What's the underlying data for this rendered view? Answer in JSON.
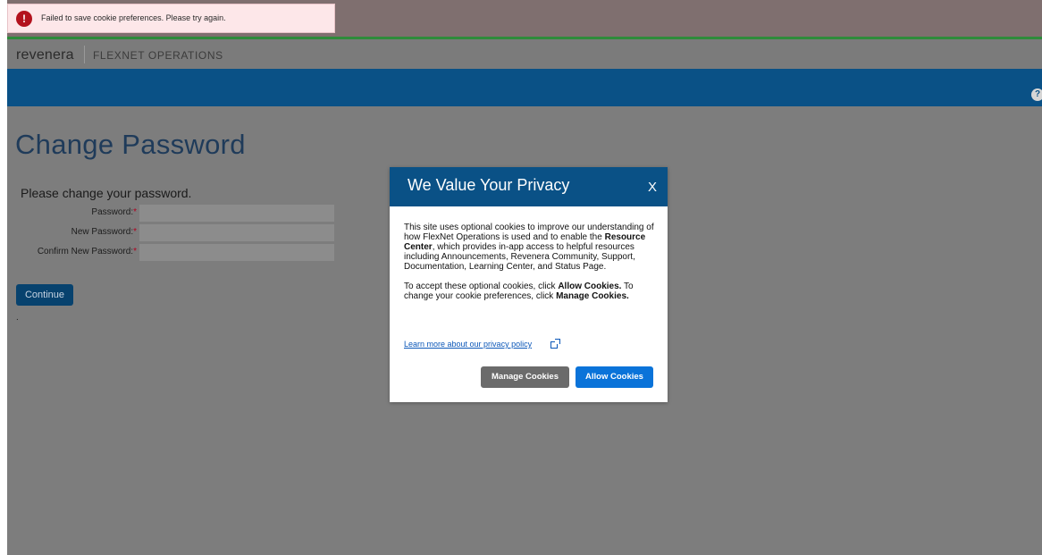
{
  "toast": {
    "icon": "error-icon",
    "message": "Failed to save cookie preferences. Please try again."
  },
  "brand": {
    "logo": "revenera",
    "product": "FLEXNET OPERATIONS"
  },
  "header": {
    "help_icon": "help-icon",
    "help_glyph": "?"
  },
  "page": {
    "title": "Change Password",
    "instructions": "Please change your password.",
    "fields": [
      {
        "label": "Password:",
        "required": "*",
        "value": ""
      },
      {
        "label": "New Password:",
        "required": "*",
        "value": ""
      },
      {
        "label": "Confirm New Password:",
        "required": "*",
        "value": ""
      }
    ],
    "continue_label": "Continue",
    "trailing_text": "."
  },
  "modal": {
    "title": "We Value Your Privacy",
    "close_label": "X",
    "para1_a": "This site uses optional cookies to improve our understanding of how FlexNet Operations is used and to enable the ",
    "para1_bold": "Resource Center",
    "para1_b": ", which provides in-app access to helpful resources including Announcements, Revenera Community, Support, Documentation, Learning Center, and Status Page.",
    "para2_a": "To accept these optional cookies, click ",
    "para2_bold1": "Allow Cookies.",
    "para2_b": " To change your cookie preferences, click ",
    "para2_bold2": "Manage Cookies.",
    "privacy_link": "Learn more about our privacy policy",
    "manage_label": "Manage Cookies",
    "allow_label": "Allow Cookies"
  },
  "colors": {
    "brand_blue": "#0a5186",
    "accent_green": "#2e8b3a",
    "allow_button": "#0a73d9",
    "error_red": "#b3121d"
  }
}
